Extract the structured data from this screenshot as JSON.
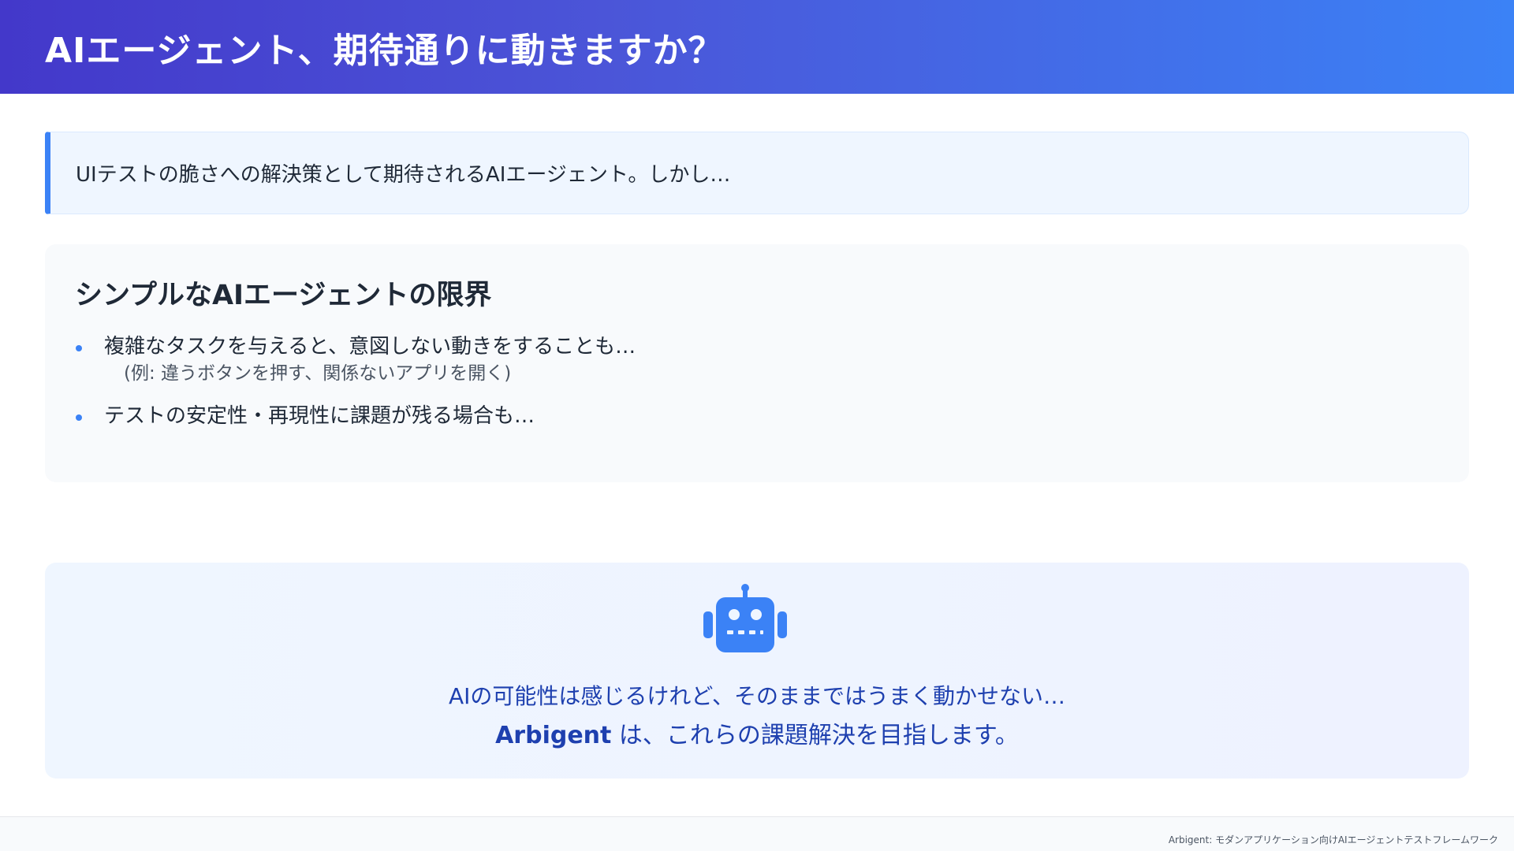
{
  "header": {
    "title": "AIエージェント、期待通りに動きますか？"
  },
  "intro": {
    "text": "UIテストの脆さへの解決策として期待されるAIエージェント。しかし…"
  },
  "limits": {
    "heading": "シンプルなAIエージェントの限界",
    "items": [
      {
        "text": "複雑なタスクを与えると、意図しない動きをすることも…",
        "sub": "(例: 違うボタンを押す、関係ないアプリを開く)"
      },
      {
        "text": "テストの安定性・再現性に課題が残る場合も…"
      }
    ]
  },
  "callout": {
    "icon": "robot-icon",
    "line1": "AIの可能性は感じるけれど、そのままではうまく動かせない…",
    "brand": "Arbigent",
    "line2_rest": " は、これらの課題解決を目指します。"
  },
  "footer": {
    "text": "Arbigent: モダンアプリケーション向けAIエージェントテストフレームワーク"
  },
  "colors": {
    "accent": "#3b82f6",
    "header_start": "#4338ca",
    "header_end": "#3b82f6",
    "callout_text": "#1e40af"
  }
}
